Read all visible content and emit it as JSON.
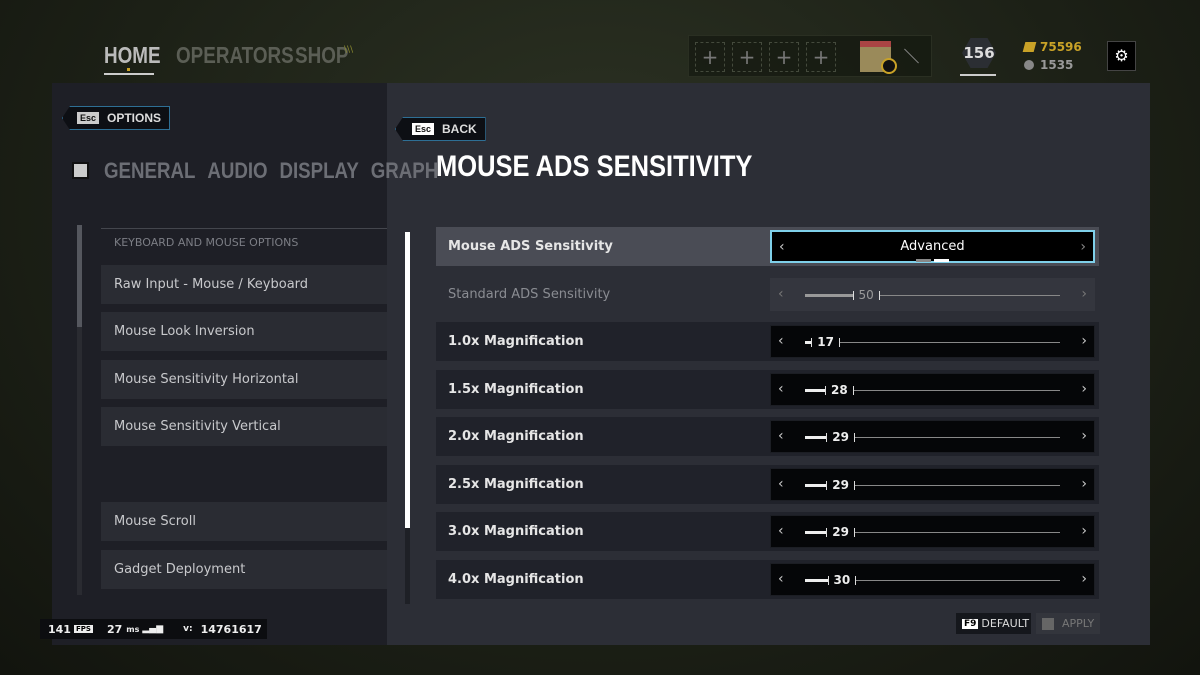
{
  "top_nav": {
    "items": [
      "HOME",
      "OPERATORS",
      "SHOP"
    ],
    "active": "HOME",
    "shop_badge": "\\\\\\"
  },
  "squad_slots": [
    "+",
    "+",
    "+",
    "+"
  ],
  "level": "156",
  "currency": {
    "renown_icon": "renown-icon",
    "renown": "75596",
    "credits_icon": "r6-credits-icon",
    "credits": "1535",
    "color_renown": "#c9a227"
  },
  "settings_icon": "gear-icon",
  "options_button": {
    "key": "Esc",
    "label": "OPTIONS"
  },
  "options_tabs": [
    "GENERAL",
    "AUDIO",
    "DISPLAY",
    "GRAPH"
  ],
  "left_list": {
    "header": "KEYBOARD AND MOUSE OPTIONS",
    "items": [
      "Raw Input - Mouse / Keyboard",
      "Mouse Look Inversion",
      "Mouse Sensitivity Horizontal",
      "Mouse Sensitivity Vertical",
      "Mouse Scroll",
      "Gadget Deployment"
    ]
  },
  "back_button": {
    "key": "Esc",
    "label": "BACK"
  },
  "title": "MOUSE ADS SENSITIVITY",
  "mode_row": {
    "label": "Mouse ADS Sensitivity",
    "value": "Advanced",
    "options_count": 2,
    "selected_index": 1
  },
  "standard_row": {
    "label": "Standard ADS Sensitivity",
    "value": 50,
    "disabled": true
  },
  "rows": [
    {
      "label": "1.0x Magnification",
      "value": 17
    },
    {
      "label": "1.5x Magnification",
      "value": 28
    },
    {
      "label": "2.0x Magnification",
      "value": 29
    },
    {
      "label": "2.5x Magnification",
      "value": 29
    },
    {
      "label": "3.0x Magnification",
      "value": 29
    },
    {
      "label": "4.0x Magnification",
      "value": 30
    }
  ],
  "footer": {
    "default_key": "F9",
    "default_label": "DEFAULT",
    "apply_label": "APPLY"
  },
  "perf": {
    "fps": "141",
    "fps_label": "FPS",
    "ping": "27",
    "ping_unit": "ms",
    "version_label": "v:",
    "version": "14761617"
  },
  "colors": {
    "accent_border": "#7fd0ea",
    "highlight_row": "#4a4c55"
  }
}
